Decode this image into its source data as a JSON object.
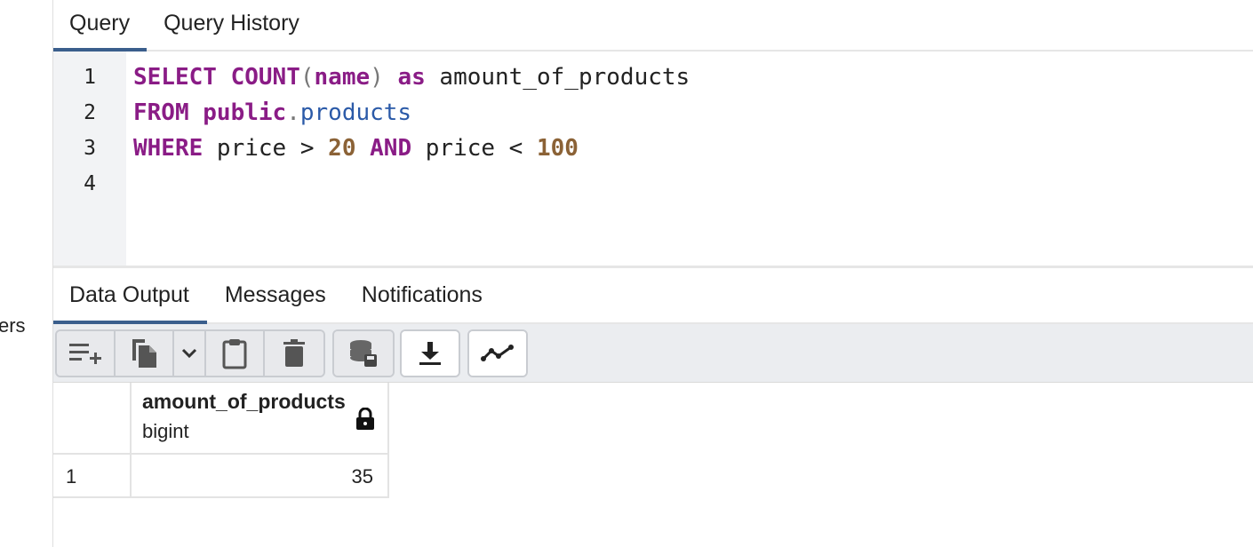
{
  "sidebar": {
    "cut_text": "ers"
  },
  "query_tabs": [
    {
      "label": "Query",
      "active": true
    },
    {
      "label": "Query History",
      "active": false
    }
  ],
  "editor": {
    "line_numbers": [
      "1",
      "2",
      "3",
      "4"
    ],
    "lines": [
      [
        "SELECT",
        " ",
        "COUNT",
        "(",
        "name",
        ")",
        " ",
        "as",
        " amount_of_products"
      ],
      [
        "FROM",
        " ",
        "public",
        ".",
        "products"
      ],
      [
        "WHERE",
        " price > ",
        "20",
        " ",
        "AND",
        " price < ",
        "100"
      ],
      []
    ]
  },
  "result_tabs": [
    {
      "label": "Data Output",
      "active": true
    },
    {
      "label": "Messages",
      "active": false
    },
    {
      "label": "Notifications",
      "active": false
    }
  ],
  "toolbar": {
    "buttons": [
      "add-row-icon",
      "copy-icon",
      "chevron-down-icon",
      "paste-icon",
      "delete-icon",
      "save-data-icon",
      "download-icon",
      "graph-icon"
    ]
  },
  "grid": {
    "columns": [
      {
        "name": "amount_of_products",
        "type": "bigint",
        "locked": true
      }
    ],
    "rows": [
      {
        "num": "1",
        "values": [
          "35"
        ]
      }
    ]
  },
  "colors": {
    "keyword": "#8a1c86",
    "number": "#8b6236",
    "table": "#2b5aa8",
    "tab_indicator": "#3a5e8c"
  }
}
